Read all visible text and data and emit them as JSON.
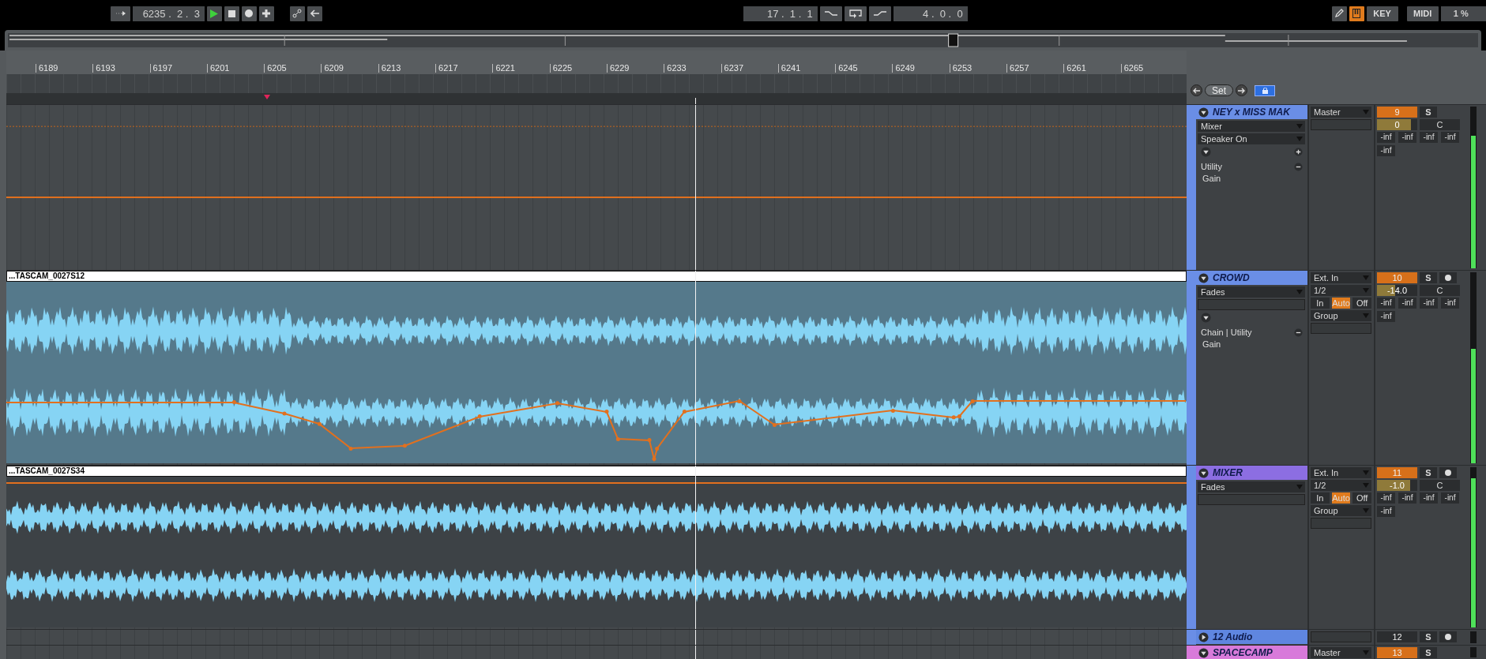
{
  "transport": {
    "position": "6235 .  2 .  3",
    "playing": true
  },
  "loop": {
    "start": "17 .  1 .  1",
    "length": "4 .  0 .  0"
  },
  "tools": [
    {
      "kind": "pencil",
      "on": false
    },
    {
      "kind": "keyboard",
      "on": true
    }
  ],
  "key_buttons": [
    "KEY",
    "MIDI"
  ],
  "cpu": "1 %",
  "ruler": [
    "6189",
    "6193",
    "6197",
    "6201",
    "6205",
    "6209",
    "6213",
    "6217",
    "6221",
    "6225",
    "6229",
    "6233",
    "6237",
    "6241",
    "6245",
    "6249",
    "6253",
    "6257",
    "6261",
    "6265"
  ],
  "set_bar": {
    "label": "Set",
    "lock_on": true
  },
  "tracks": [
    {
      "name": "NEY x MISS MAK",
      "color": "#6a8ee6",
      "expanded": true,
      "automation": true,
      "chain": [
        {
          "kind": "dropdown",
          "label": "Mixer"
        },
        {
          "kind": "dropdown",
          "label": "Speaker On"
        }
      ],
      "add_button": true,
      "device": {
        "title": "Utility",
        "parameter": "Gain"
      },
      "io": [
        {
          "kind": "dropdown",
          "label": "Master"
        },
        {
          "kind": "field"
        }
      ],
      "number": "9",
      "active": true,
      "solo": "S",
      "volume": {
        "value": "0",
        "level": 0.85
      },
      "pan": "C",
      "sends": [
        "-inf",
        "-inf",
        "-inf",
        "-inf",
        "-inf"
      ],
      "meter": {
        "level": 0.82
      },
      "children": [
        {
          "name": "CROWD",
          "color": "#6a8ee6",
          "expanded": true,
          "automation": true,
          "clip": "...TASCAM_0027S12",
          "chain": [
            {
              "kind": "dropdown",
              "label": "Fades"
            },
            {
              "kind": "field"
            }
          ],
          "device": {
            "title": "Chain | Utility",
            "parameter": "Gain"
          },
          "io": [
            {
              "kind": "dropdown",
              "label": "Ext. In"
            },
            {
              "kind": "dropdown",
              "label": "1/2"
            },
            {
              "kind": "monitor",
              "options": [
                {
                  "label": "In",
                  "selected": false
                },
                {
                  "label": "Auto",
                  "selected": true
                },
                {
                  "label": "Off",
                  "selected": false
                }
              ]
            },
            {
              "kind": "dropdown",
              "label": "Group"
            },
            {
              "kind": "field"
            }
          ],
          "number": "10",
          "active": true,
          "solo": "S",
          "arm_button": true,
          "volume": {
            "value": "-14.0",
            "level": 0.45
          },
          "pan": "C",
          "sends": [
            "-inf",
            "-inf",
            "-inf",
            "-inf",
            "-inf"
          ],
          "meter": {
            "level": 0.6
          }
        },
        {
          "name": "MIXER",
          "color": "#8c6ee2",
          "expanded": true,
          "automation": true,
          "clip": "...TASCAM_0027S34",
          "chain": [
            {
              "kind": "dropdown",
              "label": "Fades"
            },
            {
              "kind": "field"
            }
          ],
          "io": [
            {
              "kind": "dropdown",
              "label": "Ext. In"
            },
            {
              "kind": "dropdown",
              "label": "1/2"
            },
            {
              "kind": "monitor",
              "options": [
                {
                  "label": "In",
                  "selected": false
                },
                {
                  "label": "Auto",
                  "selected": true
                },
                {
                  "label": "Off",
                  "selected": false
                }
              ]
            },
            {
              "kind": "dropdown",
              "label": "Group"
            },
            {
              "kind": "field"
            }
          ],
          "number": "11",
          "active": true,
          "solo": "S",
          "arm_button": true,
          "volume": {
            "value": "-1.0",
            "level": 0.82
          },
          "pan": "C",
          "sends": [
            "-inf",
            "-inf",
            "-inf",
            "-inf",
            "-inf"
          ],
          "meter": {
            "level": 0.93
          }
        },
        {
          "name": "12 Audio",
          "color": "#5f86e0",
          "expanded": false,
          "io": [
            {
              "kind": "field"
            }
          ],
          "number": "12",
          "active": false,
          "solo": "S",
          "arm_button": true
        }
      ]
    },
    {
      "name": "SPACECAMP",
      "color": "#d87ada",
      "expanded": true,
      "io": [
        {
          "kind": "dropdown",
          "label": "Master"
        }
      ],
      "number": "13",
      "active": true,
      "solo": "S"
    }
  ]
}
